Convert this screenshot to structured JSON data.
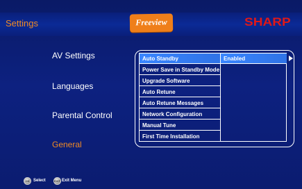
{
  "header": {
    "title": "Settings",
    "freeview_logo_text": "Freeview",
    "brand": "SHARP"
  },
  "menu": {
    "items": [
      {
        "label": "AV Settings",
        "active": false
      },
      {
        "label": "Languages",
        "active": false
      },
      {
        "label": "Parental Control",
        "active": false
      },
      {
        "label": "General",
        "active": true
      }
    ]
  },
  "general_panel": {
    "rows": [
      {
        "label": "Auto Standby",
        "selected": true
      },
      {
        "label": "Power Save in Standby Mode",
        "selected": false
      },
      {
        "label": "Upgrade Software",
        "selected": false
      },
      {
        "label": "Auto Retune",
        "selected": false
      },
      {
        "label": "Auto Retune Messages",
        "selected": false
      },
      {
        "label": "Network Configuration",
        "selected": false
      },
      {
        "label": "Manual Tune",
        "selected": false
      },
      {
        "label": "First Time Installation",
        "selected": false
      }
    ],
    "selected_value": "Enabled"
  },
  "footer": {
    "ok_icon_text": "OK",
    "select_label": "Select",
    "exit_icon_text": "EXIT",
    "exit_label": "Exit Menu"
  },
  "colors": {
    "background": "#0b1d6e",
    "accent_orange": "#f08a24",
    "highlight_blue": "#3a86ff",
    "brand_red": "#e01818"
  }
}
